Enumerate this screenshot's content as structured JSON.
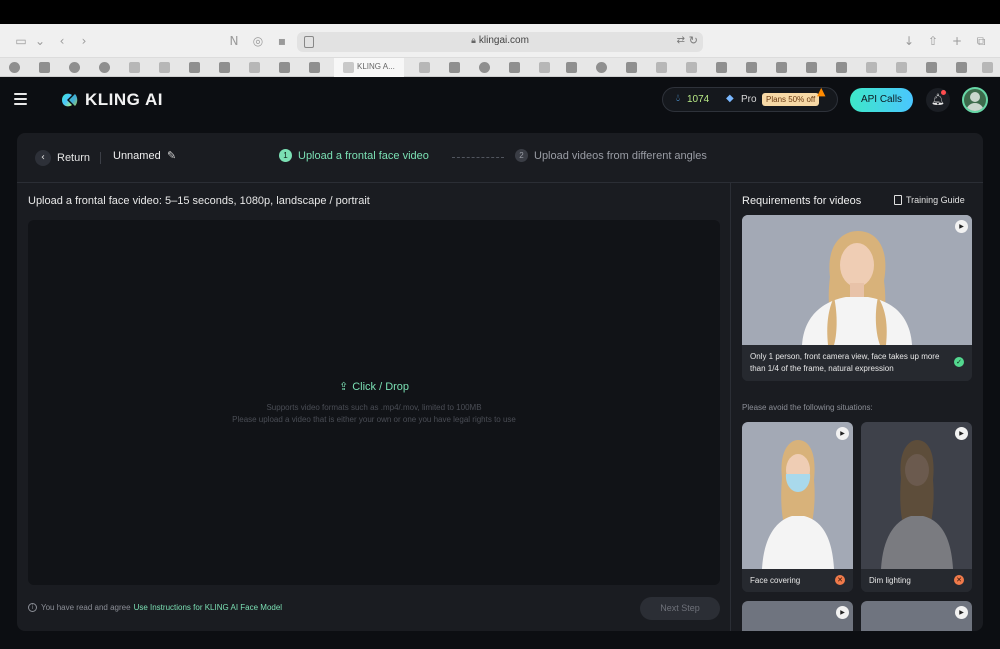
{
  "browser": {
    "url": "klingai.com",
    "active_tab_title": "KLING A..."
  },
  "header": {
    "logo_text": "KLING AI",
    "credits": "1074",
    "plan": "Pro",
    "plans_badge": "Plans 50% off",
    "api_button": "API Calls"
  },
  "steps": {
    "return_label": "Return",
    "project_name": "Unnamed",
    "step1_num": "1",
    "step1_label": "Upload a frontal face video",
    "step2_num": "2",
    "step2_label": "Upload videos from different angles"
  },
  "upload": {
    "title": "Upload a frontal face video: 5–15 seconds, 1080p, landscape / portrait",
    "click_drop": "Click / Drop",
    "hint_formats": "Supports video formats such as .mp4/.mov, limited to 100MB",
    "hint_rights": "Please upload a video that is either your own or one you have legal rights to use",
    "agree_text": "You have read and agree",
    "agree_link": "Use Instructions for KLING AI Face Model",
    "next_button": "Next Step"
  },
  "requirements": {
    "title": "Requirements for videos",
    "guide_label": "Training Guide",
    "main_caption": "Only 1 person, front camera view, face takes up more than 1/4 of the frame, natural expression",
    "avoid_title": "Please avoid the following situations:",
    "avoid_items": [
      {
        "label": "Face covering"
      },
      {
        "label": "Dim lighting"
      }
    ]
  },
  "colors": {
    "accent_green": "#7be0b4",
    "api_gradient_start": "#3ee8c8",
    "api_gradient_end": "#4ac6ff",
    "panel_bg": "#1a1c21",
    "app_bg": "#0c0e12",
    "error_badge": "#f07a4a",
    "ok_badge": "#53d88f"
  },
  "icons": {
    "menu": "hamburger-icon",
    "credits": "drop-icon",
    "plan": "diamond-icon",
    "notifications": "bell-icon",
    "upload": "upload-icon",
    "play": "play-icon"
  }
}
